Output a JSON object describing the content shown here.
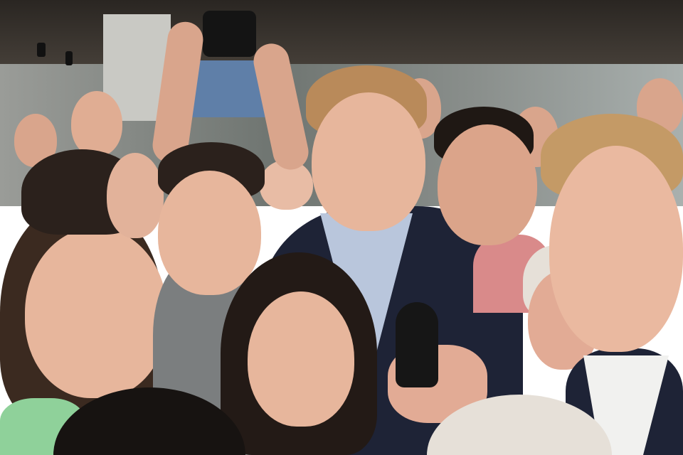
{
  "scene": {
    "colors": {
      "ceiling": "#2a2622",
      "background": "#8a8f8c",
      "window": "#5f7fa8",
      "skin": "#e7b69c",
      "skin_shadow": "#c98c72",
      "hair_dark": "#2b211c",
      "hair_blonde": "#b98a5a",
      "suit": "#1e2336",
      "shirt_blue": "#b9c6dc",
      "shirt_grey": "#7b7e7f",
      "dress_green": "#8fd19a",
      "white_hair": "#e6e0d8",
      "microphone": "#161616"
    }
  }
}
